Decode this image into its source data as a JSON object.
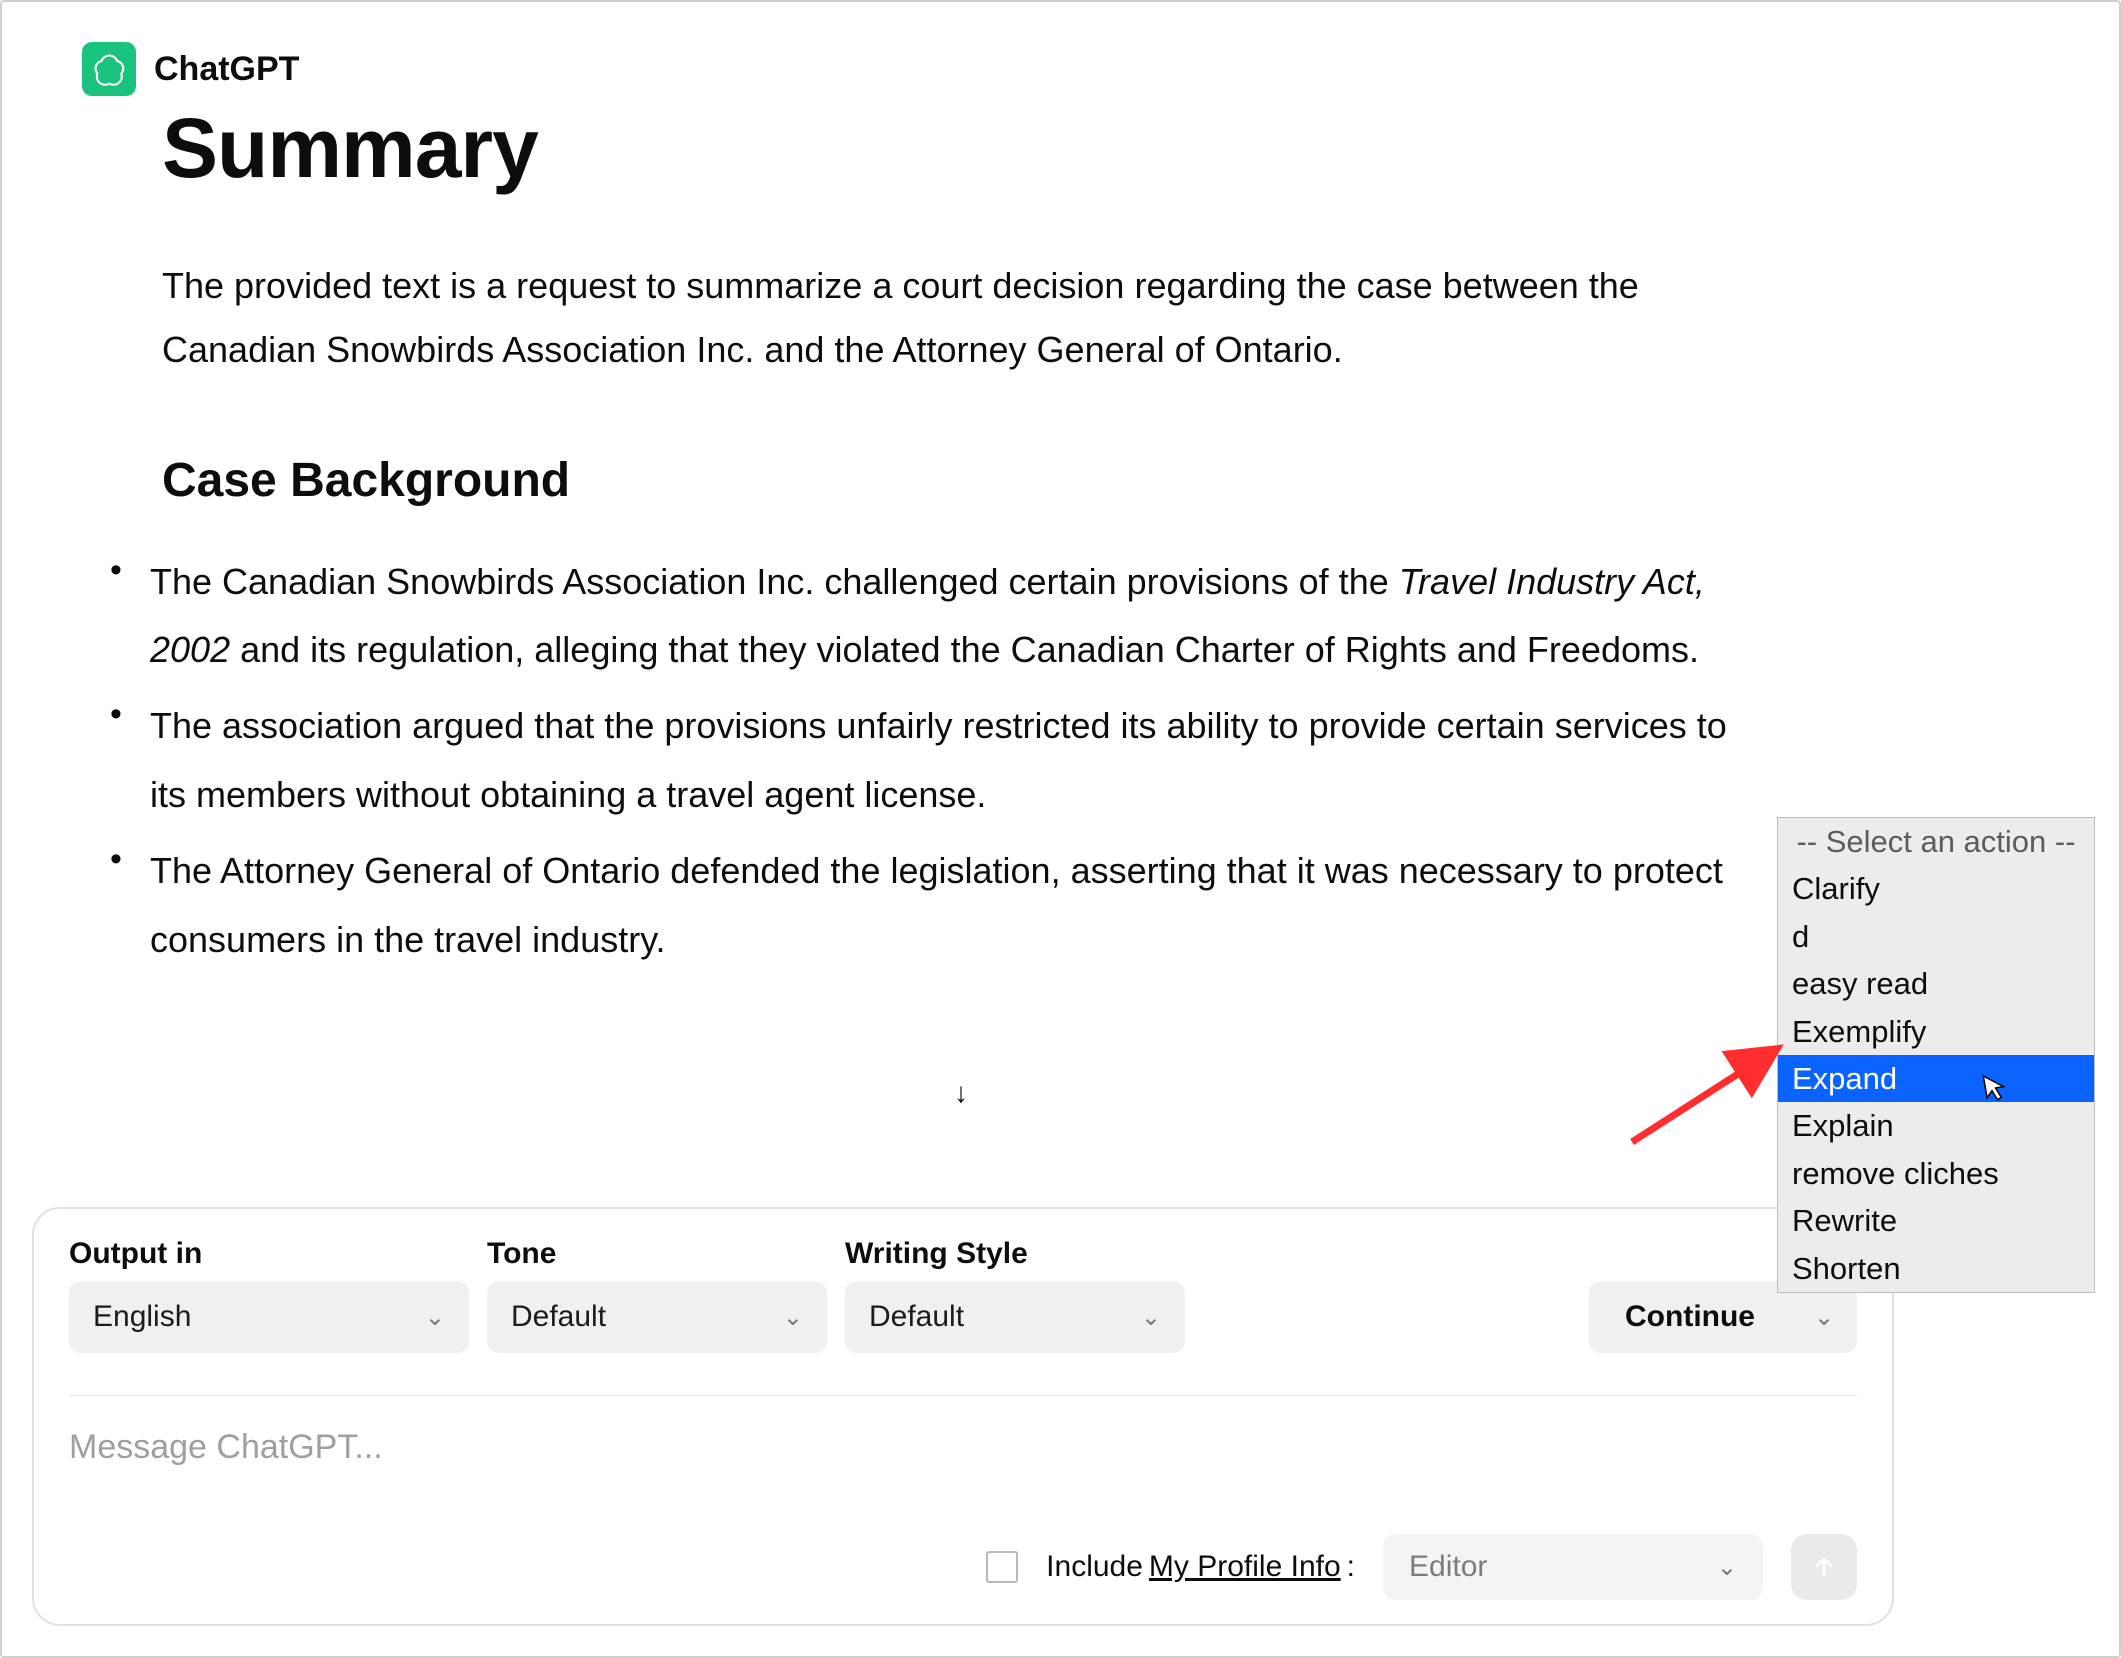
{
  "header": {
    "app_name": "ChatGPT"
  },
  "page": {
    "title": "Summary",
    "intro": "The provided text is a request to summarize a court decision regarding the case between the Canadian Snowbirds Association Inc. and the Attorney General of Ontario.",
    "section_heading": "Case Background",
    "bullets": {
      "b1_prefix": "The Canadian Snowbirds Association Inc. challenged certain provisions of the ",
      "b1_italic": "Travel Industry Act, 2002",
      "b1_suffix": " and its regulation, alleging that they violated the Canadian Charter of Rights and Freedoms.",
      "b2": "The association argued that the provisions unfairly restricted its ability to provide certain services to its members without obtaining a travel agent license.",
      "b3": "The Attorney General of Ontario defended the legislation, asserting that it was necessary to protect consumers in the travel industry."
    }
  },
  "composer": {
    "output_label": "Output in",
    "output_value": "English",
    "tone_label": "Tone",
    "tone_value": "Default",
    "style_label": "Writing Style",
    "style_value": "Default",
    "continue_label": "Continue",
    "message_placeholder": "Message ChatGPT...",
    "include_label_prefix": "Include ",
    "include_label_underlined": "My Profile Info",
    "include_label_suffix": ":",
    "role_value": "Editor"
  },
  "action_popup": {
    "header": "-- Select an action --",
    "items": {
      "i0": "Clarify",
      "i1": "d",
      "i2": "easy read",
      "i3": "Exemplify",
      "i4": "Expand",
      "i5": "Explain",
      "i6": "remove cliches",
      "i7": "Rewrite",
      "i8": "Shorten"
    },
    "highlighted": "Expand"
  },
  "icons": {
    "scroll_down": "↓"
  }
}
